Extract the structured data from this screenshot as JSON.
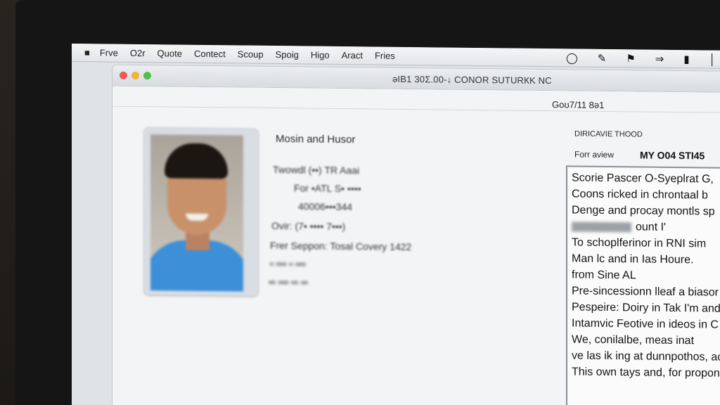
{
  "menubar": {
    "items": [
      "Frve",
      "O2r",
      "Quote",
      "Contect",
      "Scoup",
      "Spoig",
      "Higo",
      "Aract",
      "Fries"
    ],
    "status_icons": [
      "record-icon",
      "edit-icon",
      "flag-icon",
      "arrows-icon",
      "battery-icon",
      "menu-extra-icon"
    ]
  },
  "window": {
    "title": "ǝΙΒ1 30Σ.00-↓ CONOR SUTURКK NC",
    "top_right_label": "Goʊ7/11 8ǝ1"
  },
  "profile": {
    "name": "Mosin and Husor",
    "lines": [
      "Twowdl (••) TR Aaai",
      "For •ATL S• ••••",
      "40006•••344",
      "Ovir: (7• •••• 7•••)",
      "Frer Seppon: Tosal Covery 1422",
      "• ••• • •••",
      "•• ••• •• ••"
    ]
  },
  "side": {
    "header1": "DIRICAVIE THOOD",
    "header2_label": "Forr aview",
    "header2_value": "MY O04 STI45",
    "text_lines": [
      "Scorie Pascer O-Syeplrat G,",
      "Coons ricked in chrontaal b",
      "Denge and procay montls sp",
      "ount I'",
      "To schoplferinor in RNI sim",
      "Man lc and in Ias Houre.",
      "from Sine AL",
      "Pre-sincessionn lleaf a biasor",
      "Pespeire: Doiry in Tak I'm and",
      "Intamvic Feotive in ideos in C",
      "We, conilalbe, meas inat",
      "ve las ik ing at dunnpothos, acc",
      "This own tays and, for propon"
    ]
  },
  "colors": {
    "close": "#ec5b56",
    "minimize": "#f0b43a",
    "zoom": "#4fbf4b",
    "shirt": "#3d8fd8"
  }
}
